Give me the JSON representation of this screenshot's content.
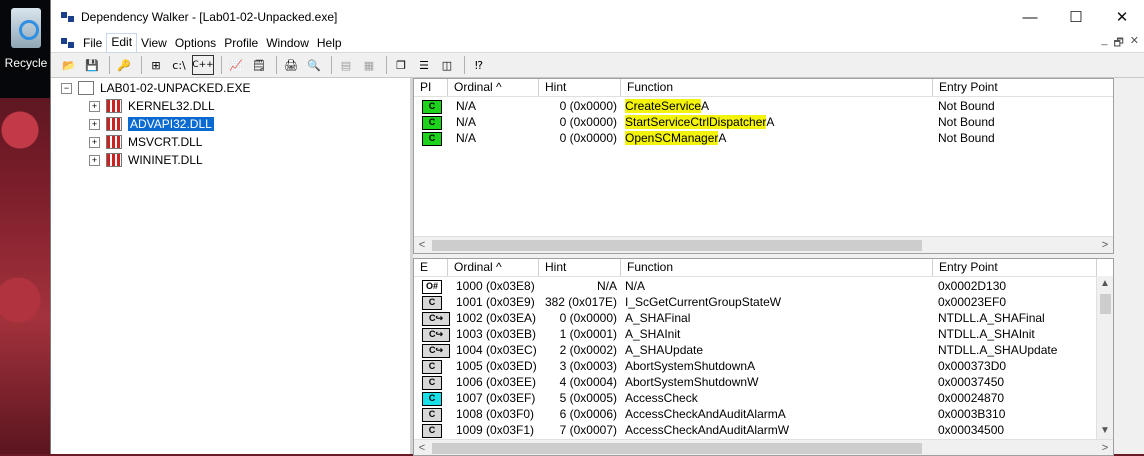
{
  "desktop": {
    "recycle_label": "Recycle"
  },
  "window": {
    "title": "Dependency Walker - [Lab01-02-Unpacked.exe]",
    "min": "—",
    "max": "☐",
    "close": "✕"
  },
  "menu": {
    "items": [
      "File",
      "Edit",
      "View",
      "Options",
      "Profile",
      "Window",
      "Help"
    ]
  },
  "mdi": {
    "min": "_",
    "restore": "🗗",
    "close": "✕"
  },
  "toolbar": {
    "buttons": [
      "open-icon",
      "save-icon",
      "find-icon",
      "tree-icon",
      "path-icon",
      "cpp-icon",
      "module-icon",
      "properties-icon",
      "print-icon",
      "view-icon",
      "copy-icon",
      "goto-icon",
      "cascade-icon",
      "tile-h-icon",
      "tile-v-icon",
      "help-icon"
    ],
    "path_text": "c:\\",
    "cpp_text": "C++"
  },
  "tree": {
    "root": "LAB01-02-UNPACKED.EXE",
    "children": [
      "KERNEL32.DLL",
      "ADVAPI32.DLL",
      "MSVCRT.DLL",
      "WININET.DLL"
    ],
    "selected_index": 1
  },
  "imports": {
    "headers": [
      "PI",
      "Ordinal ^",
      "Hint",
      "Function",
      "Entry Point"
    ],
    "rows": [
      {
        "ordinal": "N/A",
        "hint": "0 (0x0000)",
        "func_hl": "CreateService",
        "func_rest": "A",
        "entry": "Not Bound"
      },
      {
        "ordinal": "N/A",
        "hint": "0 (0x0000)",
        "func_hl": "StartServiceCtrlDispatcher",
        "func_rest": "A",
        "entry": "Not Bound"
      },
      {
        "ordinal": "N/A",
        "hint": "0 (0x0000)",
        "func_hl": "OpenSCManager",
        "func_rest": "A",
        "entry": "Not Bound"
      }
    ]
  },
  "exports": {
    "headers": [
      "E",
      "Ordinal ^",
      "Hint",
      "Function",
      "Entry Point"
    ],
    "rows": [
      {
        "icon": "O#",
        "ordinal": "1000 (0x03E8)",
        "hint": "N/A",
        "function": "N/A",
        "entry": "0x0002D130"
      },
      {
        "icon": "C",
        "ordinal": "1001 (0x03E9)",
        "hint": "382 (0x017E)",
        "function": "I_ScGetCurrentGroupStateW",
        "entry": "0x00023EF0"
      },
      {
        "icon": "C↪",
        "ordinal": "1002 (0x03EA)",
        "hint": "0 (0x0000)",
        "function": "A_SHAFinal",
        "entry": "NTDLL.A_SHAFinal"
      },
      {
        "icon": "C↪",
        "ordinal": "1003 (0x03EB)",
        "hint": "1 (0x0001)",
        "function": "A_SHAInit",
        "entry": "NTDLL.A_SHAInit"
      },
      {
        "icon": "C↪",
        "ordinal": "1004 (0x03EC)",
        "hint": "2 (0x0002)",
        "function": "A_SHAUpdate",
        "entry": "NTDLL.A_SHAUpdate"
      },
      {
        "icon": "C",
        "ordinal": "1005 (0x03ED)",
        "hint": "3 (0x0003)",
        "function": "AbortSystemShutdownA",
        "entry": "0x000373D0"
      },
      {
        "icon": "C",
        "ordinal": "1006 (0x03EE)",
        "hint": "4 (0x0004)",
        "function": "AbortSystemShutdownW",
        "entry": "0x00037450"
      },
      {
        "icon": "C",
        "ordinal": "1007 (0x03EF)",
        "hint": "5 (0x0005)",
        "function": "AccessCheck",
        "entry": "0x00024870"
      },
      {
        "icon": "C",
        "ordinal": "1008 (0x03F0)",
        "hint": "6 (0x0006)",
        "function": "AccessCheckAndAuditAlarmA",
        "entry": "0x0003B310"
      },
      {
        "icon": "C",
        "ordinal": "1009 (0x03F1)",
        "hint": "7 (0x0007)",
        "function": "AccessCheckAndAuditAlarmW",
        "entry": "0x00034500"
      }
    ]
  },
  "colors": {
    "import_icon": "#1ed21e",
    "accesscheck_icon": "#19dfe6",
    "highlight": "#f3f30c",
    "selection": "#0a6ad2"
  }
}
